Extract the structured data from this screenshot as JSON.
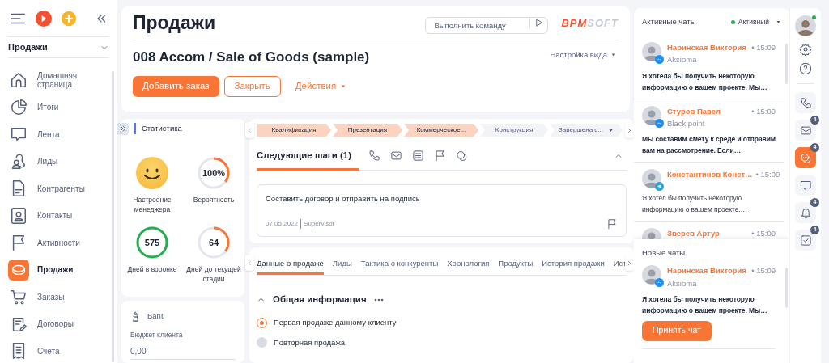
{
  "sidebar": {
    "section": "Продажи",
    "items": [
      {
        "label": "Домашняя страница",
        "selected": false
      },
      {
        "label": "Итоги",
        "selected": false
      },
      {
        "label": "Лента",
        "selected": false
      },
      {
        "label": "Лиды",
        "selected": false
      },
      {
        "label": "Контрагенты",
        "selected": false
      },
      {
        "label": "Контакты",
        "selected": false
      },
      {
        "label": "Активности",
        "selected": false
      },
      {
        "label": "Продажи",
        "selected": true
      },
      {
        "label": "Заказы",
        "selected": false
      },
      {
        "label": "Договоры",
        "selected": false
      },
      {
        "label": "Счета",
        "selected": false
      }
    ]
  },
  "header": {
    "title": "Продажи",
    "command": {
      "placeholder": "Выполнить команду"
    },
    "logo": {
      "accent": "BPM",
      "rest": "SOFT"
    },
    "record": "008 Accom / Sale of Goods (sample)",
    "view_settings": "Настройка вида",
    "buttons": [
      {
        "kind": "primary",
        "label": "Добавить заказ"
      },
      {
        "kind": "outline",
        "label": "Закрыть"
      },
      {
        "kind": "menu",
        "label": "Действия"
      }
    ]
  },
  "stats": {
    "title": "Статистика",
    "mood": {
      "label": "Настроение менеджера"
    },
    "metrics": [
      {
        "value": "100%",
        "label": "Вероятность",
        "level": 0.35,
        "color": "#f97535"
      },
      {
        "value": "575",
        "label": "Дней в воронке",
        "level": 1,
        "color": "#22b14c"
      },
      {
        "value": "64",
        "label": "Дней до текущей стадии",
        "level": 0.35,
        "color": "#f97535"
      }
    ]
  },
  "bant": {
    "title": "Bant",
    "field": {
      "label": "Бюджет клиента",
      "value": "0,00"
    }
  },
  "stages": [
    {
      "label": "Квалификация",
      "done": true,
      "dropdown": false
    },
    {
      "label": "Презентация",
      "done": true,
      "dropdown": false
    },
    {
      "label": "Коммерческое...",
      "done": true,
      "dropdown": false
    },
    {
      "label": "Конструкция",
      "done": false,
      "dropdown": false
    },
    {
      "label": "Завершена с...",
      "done": false,
      "dropdown": true
    }
  ],
  "next_steps": {
    "title": "Следующие шаги (1)",
    "task": {
      "text": "Составить договор и отправить на подпись",
      "date": "07.05.2022",
      "owner": "Supervisor"
    }
  },
  "tabs": [
    {
      "label": "Данные о продаже",
      "selected": true
    },
    {
      "label": "Лиды",
      "selected": false
    },
    {
      "label": "Тактика о конкуренты",
      "selected": false
    },
    {
      "label": "Хронология",
      "selected": false
    },
    {
      "label": "Продукты",
      "selected": false
    },
    {
      "label": "История продажи",
      "selected": false
    },
    {
      "label": "Ист",
      "selected": false
    }
  ],
  "general": {
    "title": "Общая информация",
    "options": [
      {
        "label": "Первая продаже данному клиенту",
        "selected": true
      },
      {
        "label": "Повторная продажа",
        "selected": false
      }
    ]
  },
  "active_chats": {
    "title": "Активные чаты",
    "status": {
      "label": "Активный",
      "color": "#22b14c"
    },
    "items": [
      {
        "name": "Наринская Виктория",
        "time": "• 15:09",
        "company": "Aksioma",
        "message": "Я хотела бы получить некоторую информацию о вашем проекте. Мы…",
        "unread": true,
        "kind": "messenger"
      },
      {
        "name": "Стуров Павел",
        "time": "• 15:09",
        "company": "Black point",
        "message": "Мы составим смету к среде и отправим вам на рассмотрение. Если…",
        "unread": true,
        "kind": "messenger"
      },
      {
        "name": "Константинов Конст…",
        "time": "• 15:09",
        "message": "Я хотел бы получить некоторую информацию о вашем проекте.…",
        "unread": false,
        "kind": "telegram"
      },
      {
        "name": "Зверев Артур",
        "time": "• 15:09"
      }
    ]
  },
  "new_chats": {
    "title": "Новые чаты",
    "items": [
      {
        "name": "Наринская Виктория",
        "time": "• 15:09",
        "company": "Aksioma",
        "message": "Я хотела бы получить некоторую информацию о вашем проекте. Мы…",
        "unread": true,
        "kind": "messenger"
      }
    ],
    "accept": "Принять чат"
  },
  "rail": [
    {
      "kind": "phone",
      "selected": false
    },
    {
      "kind": "mail",
      "badge": "4",
      "selected": false
    },
    {
      "kind": "chat",
      "badge": "4",
      "selected": true
    },
    {
      "kind": "message",
      "selected": false
    },
    {
      "kind": "bell",
      "badge": "4",
      "selected": false
    },
    {
      "kind": "check",
      "badge": "4",
      "selected": false
    }
  ]
}
